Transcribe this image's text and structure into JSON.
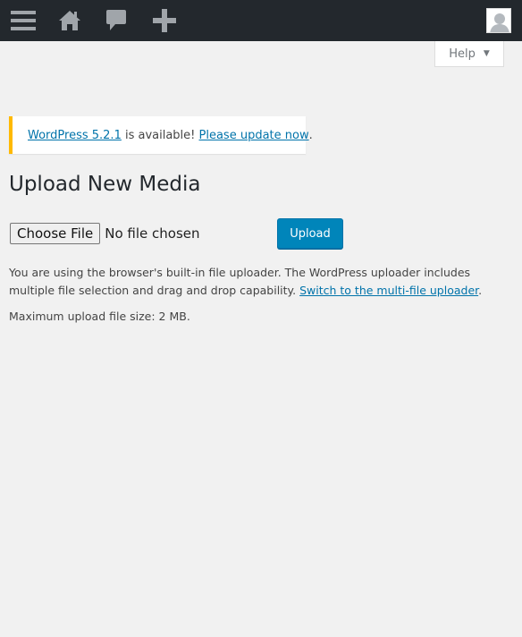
{
  "admin_bar": {
    "items": [
      {
        "icon": "menu-icon"
      },
      {
        "icon": "home-icon"
      },
      {
        "icon": "comments-icon"
      },
      {
        "icon": "plus-icon"
      },
      {
        "icon": "avatar-icon"
      }
    ],
    "colors": {
      "background": "#23282d",
      "icon": "#a0a5aa"
    }
  },
  "help_tab": {
    "label": "Help",
    "arrow": "▼"
  },
  "notice": {
    "link_version": "WordPress 5.2.1",
    "text_middle": " is available! ",
    "link_update": "Please update now",
    "text_end": ".",
    "accent_color": "#ffb900"
  },
  "page": {
    "title": "Upload New Media"
  },
  "uploader": {
    "choose_file_label": "Choose File",
    "no_file_text": "No file chosen",
    "upload_label": "Upload",
    "info_text": "You are using the browser's built-in file uploader. The WordPress uploader includes multiple file selection and drag and drop capability. ",
    "switch_link": "Switch to the multi-file uploader",
    "info_end": ".",
    "max_size_text": "Maximum upload file size: 2 MB."
  }
}
